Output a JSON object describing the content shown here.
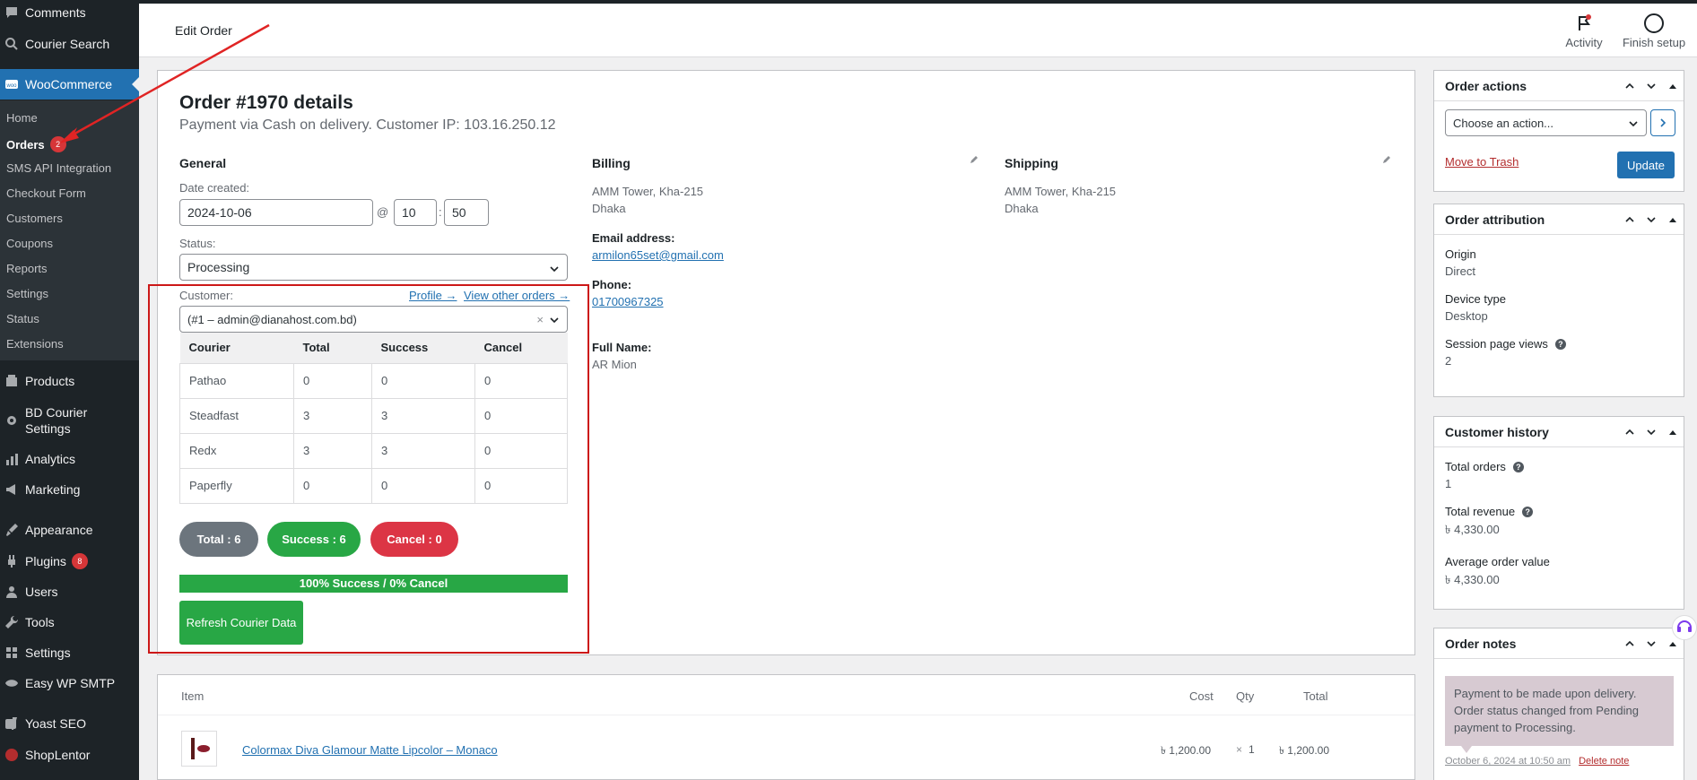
{
  "sidebar": {
    "items_top": [
      {
        "label": "Comments",
        "icon": "comment-icon"
      },
      {
        "label": "Courier Search",
        "icon": "search-icon"
      }
    ],
    "woocommerce": {
      "label": "WooCommerce",
      "icon": "woocommerce-icon"
    },
    "submenu": [
      {
        "label": "Home"
      },
      {
        "label": "Orders",
        "badge": "2"
      },
      {
        "label": "SMS API Integration"
      },
      {
        "label": "Checkout Form"
      },
      {
        "label": "Customers"
      },
      {
        "label": "Coupons"
      },
      {
        "label": "Reports"
      },
      {
        "label": "Settings"
      },
      {
        "label": "Status"
      },
      {
        "label": "Extensions"
      }
    ],
    "items_bottom": [
      {
        "label": "Products",
        "icon": "products-icon"
      },
      {
        "label": "BD Courier Settings",
        "icon": "gear-icon"
      },
      {
        "label": "Analytics",
        "icon": "analytics-icon"
      },
      {
        "label": "Marketing",
        "icon": "megaphone-icon"
      },
      {
        "label": "Appearance",
        "icon": "paintbrush-icon"
      },
      {
        "label": "Plugins",
        "icon": "plugin-icon",
        "badge": "8"
      },
      {
        "label": "Users",
        "icon": "user-icon"
      },
      {
        "label": "Tools",
        "icon": "wrench-icon"
      },
      {
        "label": "Settings",
        "icon": "settings-icon"
      },
      {
        "label": "Easy WP SMTP",
        "icon": "smtp-icon"
      },
      {
        "label": "Yoast SEO",
        "icon": "yoast-icon"
      },
      {
        "label": "ShopLentor",
        "icon": "shoplentor-icon"
      }
    ]
  },
  "header": {
    "title": "Edit Order",
    "activity": "Activity",
    "finish_setup": "Finish setup"
  },
  "order": {
    "heading": "Order #1970 details",
    "subheading": "Payment via Cash on delivery. Customer IP: 103.16.250.12",
    "general": {
      "title": "General",
      "date_label": "Date created:",
      "date": "2024-10-06",
      "at": "@",
      "hour": "10",
      "colon": ":",
      "minute": "50",
      "status_label": "Status:",
      "status": "Processing",
      "customer_label": "Customer:",
      "profile_link": "Profile →",
      "other_orders_link": "View other orders →",
      "customer_value": "(#1 – admin@dianahost.com.bd)"
    },
    "billing": {
      "title": "Billing",
      "address_line1": "AMM Tower, Kha-215",
      "address_line2": "Dhaka",
      "email_label": "Email address:",
      "email": "armilon65set@gmail.com",
      "phone_label": "Phone:",
      "phone": "01700967325",
      "fullname_label": "Full Name:",
      "fullname": "AR Mion"
    },
    "shipping": {
      "title": "Shipping",
      "address_line1": "AMM Tower, Kha-215",
      "address_line2": "Dhaka"
    }
  },
  "courier": {
    "headers": [
      "Courier",
      "Total",
      "Success",
      "Cancel"
    ],
    "rows": [
      [
        "Pathao",
        "0",
        "0",
        "0"
      ],
      [
        "Steadfast",
        "3",
        "3",
        "0"
      ],
      [
        "Redx",
        "3",
        "3",
        "0"
      ],
      [
        "Paperfly",
        "0",
        "0",
        "0"
      ]
    ],
    "total_pill": "Total : 6",
    "success_pill": "Success : 6",
    "cancel_pill": "Cancel : 0",
    "progress_text": "100% Success / 0% Cancel",
    "success_rate": 1.0,
    "refresh_label": "Refresh Courier Data"
  },
  "order_actions": {
    "title": "Order actions",
    "select_value": "Choose an action...",
    "trash": "Move to Trash",
    "update": "Update"
  },
  "attribution": {
    "title": "Order attribution",
    "origin_label": "Origin",
    "origin": "Direct",
    "device_label": "Device type",
    "device": "Desktop",
    "views_label": "Session page views",
    "views": "2"
  },
  "customer_history": {
    "title": "Customer history",
    "orders_label": "Total orders",
    "orders": "1",
    "revenue_label": "Total revenue",
    "revenue": "৳ 4,330.00",
    "avg_label": "Average order value",
    "avg": "৳ 4,330.00"
  },
  "order_notes": {
    "title": "Order notes",
    "note_text": "Payment to be made upon delivery. Order status changed from Pending payment to Processing.",
    "note_date": "October 6, 2024 at 10:50 am",
    "delete": "Delete note"
  },
  "items": {
    "col_item": "Item",
    "col_cost": "Cost",
    "col_qty": "Qty",
    "col_total": "Total",
    "product_name": "Colormax Diva Glamour Matte Lipcolor – Monaco",
    "cost": "৳ 1,200.00",
    "qty_x": "×",
    "qty": "1",
    "total": "৳ 1,200.00"
  },
  "colors": {
    "accent": "#2271b1",
    "success": "#28a745",
    "danger": "#dc3545",
    "highlight": "#cc1818"
  }
}
